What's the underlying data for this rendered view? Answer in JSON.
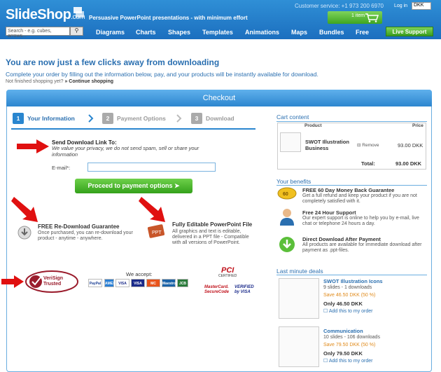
{
  "header": {
    "logo": "SlideShop",
    "logo_suffix": ".com",
    "tagline": "Persuasive PowerPoint presentations - with minimum effort",
    "customer_service": "Customer service: +1 973 200 6970",
    "login": "Log in",
    "currency": "DKK",
    "cart_label": "1 item",
    "search_placeholder": "Search - e.g. cubes, arrows...",
    "nav": [
      "Diagrams",
      "Charts",
      "Shapes",
      "Templates",
      "Animations",
      "Maps",
      "Bundles",
      "Free"
    ],
    "live_support": "Live Support"
  },
  "page": {
    "title": "You are now just a few clicks away from downloading",
    "subtitle": "Complete your order by filling out the information below, pay, and your products will be instantly available for download.",
    "not_finished": "Not finished shopping yet?",
    "continue": "» Continue shopping"
  },
  "checkout": {
    "title": "Checkout",
    "steps": [
      {
        "num": "1",
        "label": "Your Information"
      },
      {
        "num": "2",
        "label": "Payment Options"
      },
      {
        "num": "3",
        "label": "Download"
      }
    ],
    "send_title": "Send Download Link To:",
    "privacy": "We value your privacy, we do not send spam, sell or share your information",
    "email_label": "E-mail*:",
    "proceed": "Proceed to payment options",
    "f1_title": "FREE Re-Download Guarantee",
    "f1_desc": "Once purchased, you can re-download your product - anytime - anywhere.",
    "f2_title": "Fully Editable PowerPoint File",
    "f2_desc": "All graphics and text is editable, delivered in a PPT file - Compatible with all versions of PowerPoint.",
    "verisign": "VeriSign Trusted",
    "accept": "We accept:",
    "cards": [
      "PayPal",
      "AMEX",
      "VISA",
      "VISA",
      "MC",
      "Maestro",
      "JCB"
    ],
    "pci": "PCI",
    "pci_sub": "CERTIFIED",
    "mc_secure": "MasterCard. SecureCode",
    "verified_visa": "VERIFIED by VISA"
  },
  "cart": {
    "title": "Cart content",
    "col_product": "Product",
    "col_price": "Price",
    "item_name": "SWOT Illustration Business",
    "remove": "Remove",
    "item_price": "93.00 DKK",
    "total_label": "Total:",
    "total_value": "93.00 DKK"
  },
  "benefits": {
    "title": "Your benefits",
    "items": [
      {
        "title": "FREE 60 Day Money Back Guarantee",
        "desc": "Get a full refund and keep your product if you are not completely satisfied with it."
      },
      {
        "title": "Free 24 Hour Support",
        "desc": "Our expert support is online to help you by e-mail, live chat or telephone 24 hours a day."
      },
      {
        "title": "Direct Download After Payment",
        "desc": "All products are available for immediate download after payment as .ppt-files."
      }
    ]
  },
  "deals": {
    "title": "Last minute deals",
    "items": [
      {
        "title": "SWOT Illustration Icons",
        "meta": "9 slides - 1 downloads",
        "save": "Save 46.50 DKK (50 %)",
        "only": "Only 46.50 DKK",
        "add": "Add this to my order"
      },
      {
        "title": "Communication",
        "meta": "10 slides - 106 downloads",
        "save": "Save 79.50 DKK (50 %)",
        "only": "Only 79.50 DKK",
        "add": "Add this to my order"
      }
    ]
  },
  "colors": {
    "brand_blue": "#1c6fbf",
    "accent_green": "#3ea520",
    "link": "#2a6fb0"
  }
}
